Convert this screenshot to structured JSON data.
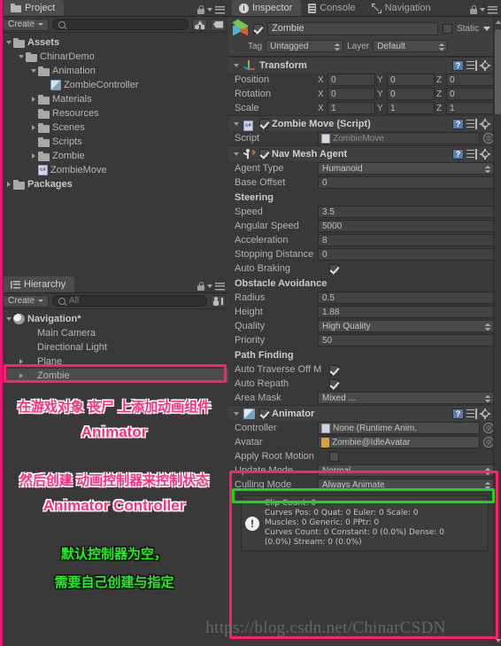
{
  "project_panel": {
    "tabs": [
      {
        "label": "Project",
        "icon": "folder-icon",
        "active": true
      }
    ],
    "create_label": "Create",
    "search_placeholder": "",
    "tree": [
      {
        "label": "Assets",
        "depth": 0,
        "arrow": "open",
        "icon": "folder-icon",
        "bold": true
      },
      {
        "label": "ChinarDemo",
        "depth": 1,
        "arrow": "open",
        "icon": "folder-icon",
        "bold": false
      },
      {
        "label": "Animation",
        "depth": 2,
        "arrow": "open",
        "icon": "folder-icon",
        "bold": false
      },
      {
        "label": "ZombieController",
        "depth": 3,
        "arrow": "none",
        "icon": "animator-controller-icon",
        "bold": false
      },
      {
        "label": "Materials",
        "depth": 2,
        "arrow": "closed",
        "icon": "folder-icon",
        "bold": false
      },
      {
        "label": "Resources",
        "depth": 2,
        "arrow": "none",
        "icon": "folder-icon",
        "bold": false
      },
      {
        "label": "Scenes",
        "depth": 2,
        "arrow": "closed",
        "icon": "folder-icon",
        "bold": false
      },
      {
        "label": "Scripts",
        "depth": 2,
        "arrow": "none",
        "icon": "folder-icon",
        "bold": false
      },
      {
        "label": "Zombie",
        "depth": 2,
        "arrow": "closed",
        "icon": "folder-icon",
        "bold": false
      },
      {
        "label": "ZombieMove",
        "depth": 2,
        "arrow": "none",
        "icon": "csharp-script-icon",
        "bold": false
      },
      {
        "label": "Packages",
        "depth": 0,
        "arrow": "closed",
        "icon": "folder-icon",
        "bold": true
      }
    ]
  },
  "hierarchy_panel": {
    "tabs": [
      {
        "label": "Hierarchy",
        "icon": "hierarchy-icon",
        "active": true
      }
    ],
    "create_label": "Create",
    "search_value": "All",
    "tree": [
      {
        "label": "Navigation*",
        "depth": 0,
        "arrow": "open",
        "icon": "scene-icon",
        "bold": true,
        "selected": false
      },
      {
        "label": "Main Camera",
        "depth": 1,
        "arrow": "none",
        "icon": "",
        "bold": false,
        "selected": false
      },
      {
        "label": "Directional Light",
        "depth": 1,
        "arrow": "none",
        "icon": "",
        "bold": false,
        "selected": false
      },
      {
        "label": "Plane",
        "depth": 1,
        "arrow": "closed",
        "icon": "",
        "bold": false,
        "selected": false
      },
      {
        "label": "Zombie",
        "depth": 1,
        "arrow": "closed",
        "icon": "",
        "bold": false,
        "selected": true
      }
    ]
  },
  "inspector": {
    "tabs": [
      {
        "label": "Inspector",
        "icon": "info-icon",
        "active": true
      },
      {
        "label": "Console",
        "icon": "console-icon",
        "active": false
      },
      {
        "label": "Navigation",
        "icon": "navigation-icon",
        "active": false
      }
    ],
    "game_object": {
      "enabled": true,
      "name": "Zombie",
      "static_label": "Static",
      "static_checked": false,
      "tag_label": "Tag",
      "tag_value": "Untagged",
      "layer_label": "Layer",
      "layer_value": "Default"
    },
    "components": [
      {
        "name": "Transform",
        "icon": "transform-icon",
        "has_checkbox": false,
        "rows": [
          {
            "type": "vector3",
            "label": "Position",
            "x": "0",
            "y": "0",
            "z": "0"
          },
          {
            "type": "vector3",
            "label": "Rotation",
            "x": "0",
            "y": "0",
            "z": "0"
          },
          {
            "type": "vector3",
            "label": "Scale",
            "x": "1",
            "y": "1",
            "z": "1"
          }
        ]
      },
      {
        "name": "Zombie Move (Script)",
        "icon": "csharp-script-icon",
        "has_checkbox": true,
        "checked": true,
        "rows": [
          {
            "type": "object",
            "label": "Script",
            "value": "ZombieMove",
            "disabled": true,
            "icon": "csharp-script-icon"
          }
        ]
      },
      {
        "name": "Nav Mesh Agent",
        "icon": "navmesh-agent-icon",
        "has_checkbox": true,
        "checked": true,
        "rows": [
          {
            "type": "popup",
            "label": "Agent Type",
            "value": "Humanoid"
          },
          {
            "type": "field",
            "label": "Base Offset",
            "value": "0"
          },
          {
            "type": "header",
            "label": "Steering"
          },
          {
            "type": "field",
            "label": "Speed",
            "value": "3.5"
          },
          {
            "type": "field",
            "label": "Angular Speed",
            "value": "5000"
          },
          {
            "type": "field",
            "label": "Acceleration",
            "value": "8"
          },
          {
            "type": "field",
            "label": "Stopping Distance",
            "value": "0"
          },
          {
            "type": "checkbox",
            "label": "Auto Braking",
            "checked": true
          },
          {
            "type": "header",
            "label": "Obstacle Avoidance"
          },
          {
            "type": "field",
            "label": "Radius",
            "value": "0.5"
          },
          {
            "type": "field",
            "label": "Height",
            "value": "1.88"
          },
          {
            "type": "popup",
            "label": "Quality",
            "value": "High Quality"
          },
          {
            "type": "field",
            "label": "Priority",
            "value": "50"
          },
          {
            "type": "header",
            "label": "Path Finding"
          },
          {
            "type": "checkbox",
            "label": "Auto Traverse Off M",
            "checked": true
          },
          {
            "type": "checkbox",
            "label": "Auto Repath",
            "checked": true
          },
          {
            "type": "popup",
            "label": "Area Mask",
            "value": "Mixed ..."
          }
        ]
      },
      {
        "name": "Animator",
        "icon": "animator-icon",
        "has_checkbox": true,
        "checked": true,
        "rows": [
          {
            "type": "object",
            "label": "Controller",
            "value": "None (Runtime Anim.",
            "disabled": false,
            "icon": "runtime-controller-icon",
            "highlight": "green"
          },
          {
            "type": "object",
            "label": "Avatar",
            "value": "Zombie@IdleAvatar",
            "disabled": false,
            "icon": "avatar-icon"
          },
          {
            "type": "checkbox",
            "label": "Apply Root Motion",
            "checked": false
          },
          {
            "type": "popup",
            "label": "Update Mode",
            "value": "Normal"
          },
          {
            "type": "popup",
            "label": "Culling Mode",
            "value": "Always Animate"
          }
        ],
        "info_box": "Clip Count: 0\nCurves Pos: 0 Quat: 0 Euler: 0 Scale: 0\nMuscles: 0 Generic: 0 PPtr: 0\nCurves Count: 0 Constant: 0 (0.0%) Dense: 0\n(0.0%) Stream: 0 (0.0%)"
      }
    ]
  },
  "annotations": {
    "note1_cn": "在游戏对象 丧尸 上添加动画组件",
    "note1_en": "Animator",
    "note2_cn": "然后创建 动画控制器来控制状态",
    "note2_en": "Animator Controller",
    "note3_cn": "默认控制器为空，",
    "note4_cn": "需要自己创建与指定",
    "watermark": "https://blog.csdn.net/ChinarCSDN",
    "colors": {
      "pink": "#ff2e7e",
      "green": "#22ee22",
      "highlight_pink": "#ff1f6b",
      "highlight_green": "#16d916"
    }
  }
}
